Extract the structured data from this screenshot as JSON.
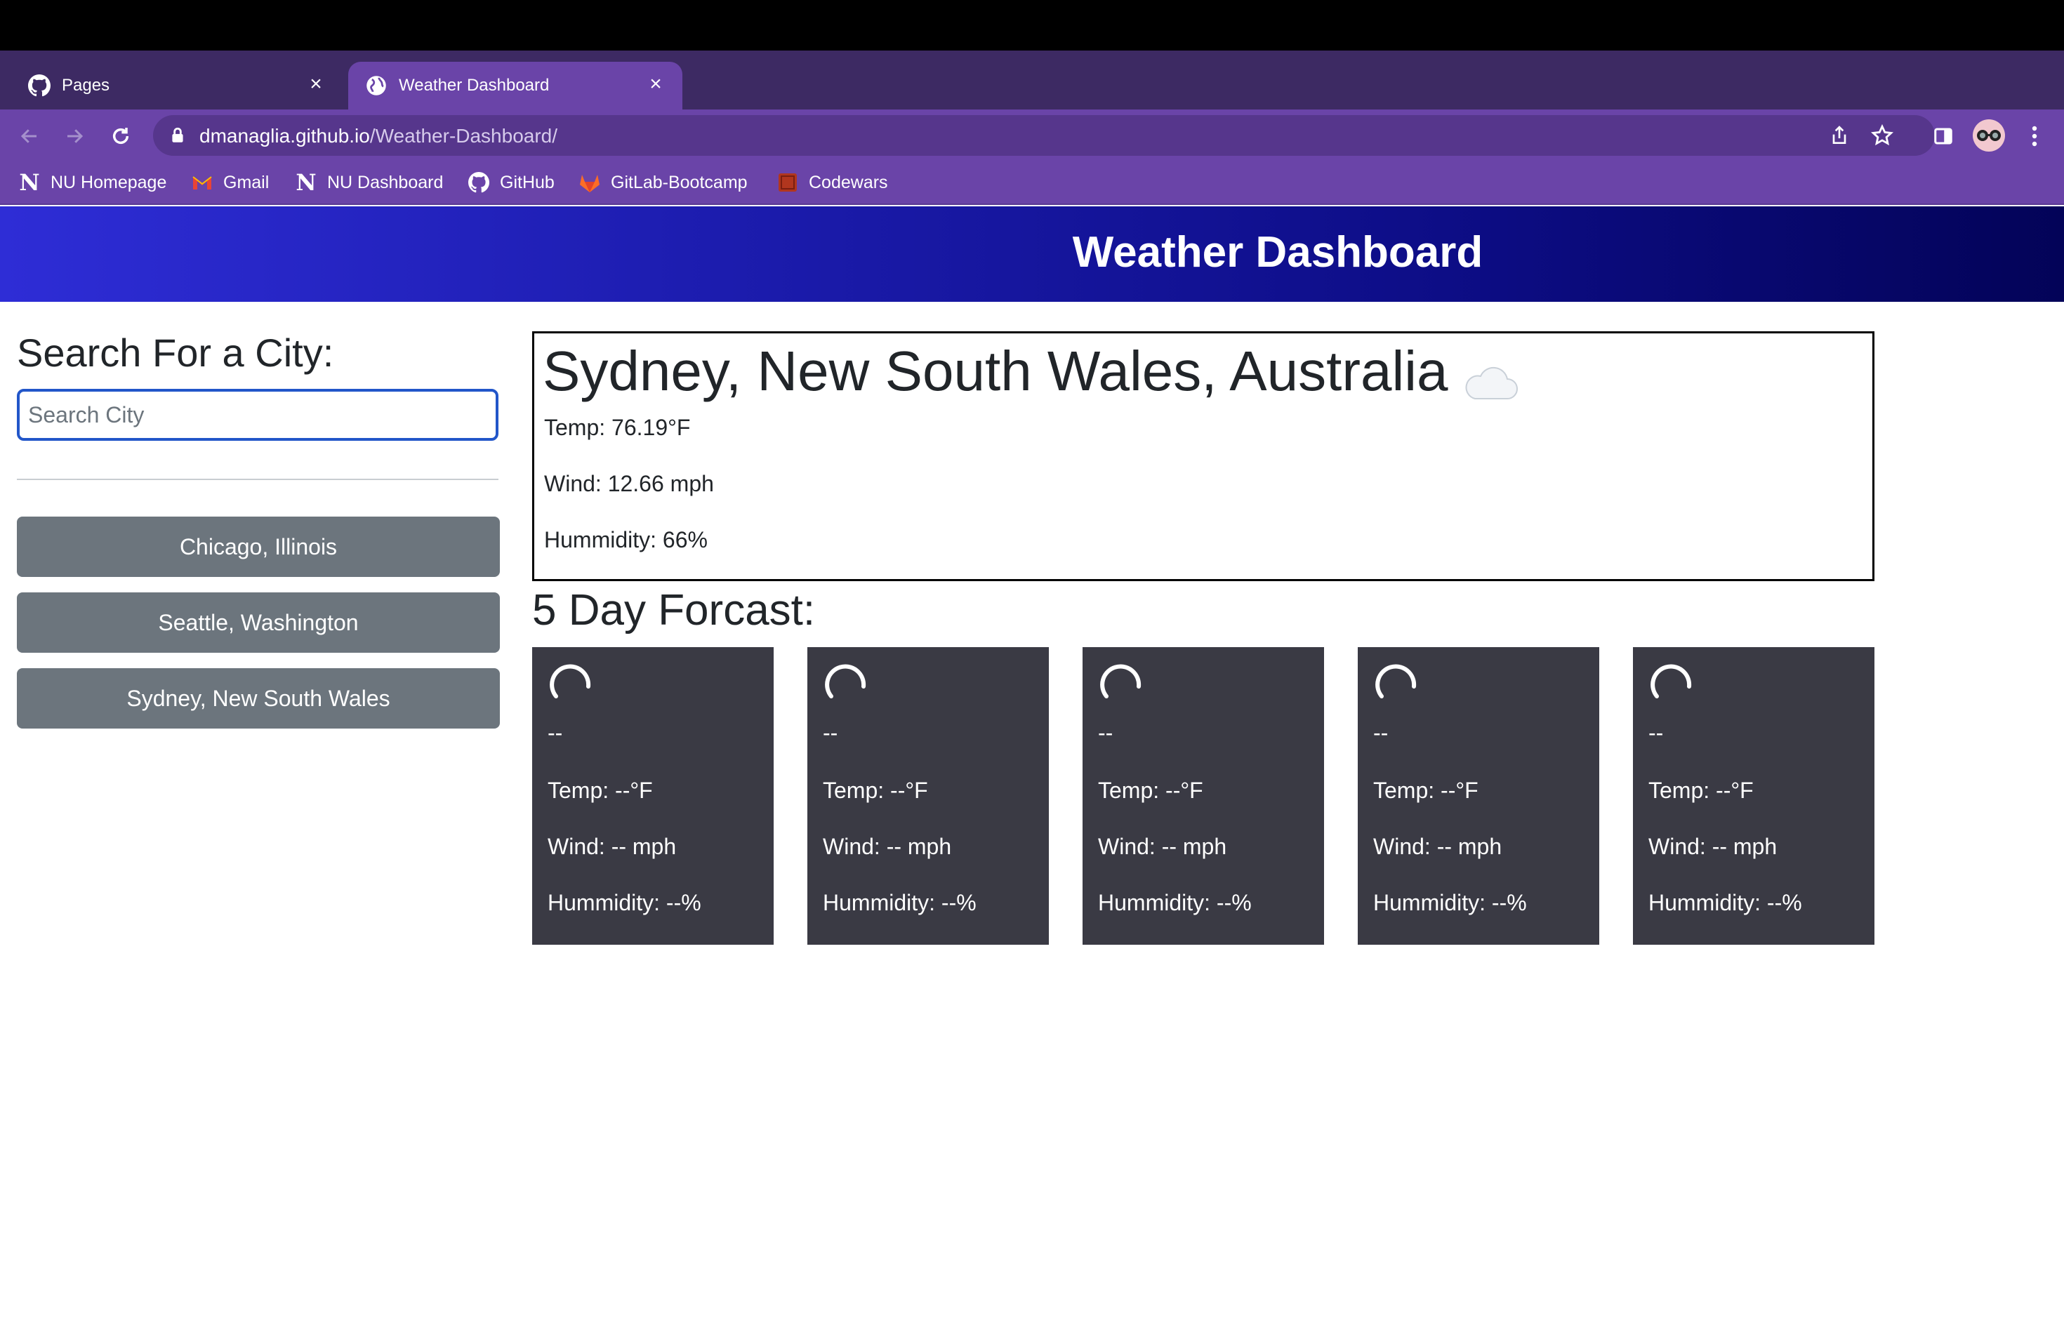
{
  "browser": {
    "tabs": [
      {
        "title": "Pages",
        "icon": "github-icon",
        "active": false
      },
      {
        "title": "Weather Dashboard",
        "icon": "globe-icon",
        "active": true
      }
    ],
    "url_host": "dmanaglia.github.io",
    "url_path": "/Weather-Dashboard/",
    "bookmarks": [
      {
        "label": "NU Homepage",
        "icon": "northwestern-n-icon"
      },
      {
        "label": "Gmail",
        "icon": "gmail-icon"
      },
      {
        "label": "NU Dashboard",
        "icon": "northwestern-n-icon"
      },
      {
        "label": "GitHub",
        "icon": "github-icon"
      },
      {
        "label": "GitLab-Bootcamp",
        "icon": "gitlab-icon"
      },
      {
        "label": "Codewars",
        "icon": "codewars-icon"
      }
    ],
    "theme_color": "#6a44a8"
  },
  "app": {
    "title": "Weather Dashboard",
    "header_gradient": [
      "#2e2dd6",
      "#030358"
    ]
  },
  "search": {
    "heading": "Search For a City:",
    "placeholder": "Search City",
    "value": "",
    "history": [
      "Chicago, Illinois",
      "Seattle, Washington",
      "Sydney, New South Wales"
    ]
  },
  "current": {
    "city": "Sydney, New South Wales, Australia",
    "icon": "cloud-icon",
    "temp": "Temp: 76.19°F",
    "wind": "Wind: 12.66 mph",
    "humidity": "Hummidity: 66%"
  },
  "forecast": {
    "heading": "5 Day Forcast:",
    "days": [
      {
        "date": "--",
        "temp": "Temp: --°F",
        "wind": "Wind: -- mph",
        "humidity": "Hummidity: --%"
      },
      {
        "date": "--",
        "temp": "Temp: --°F",
        "wind": "Wind: -- mph",
        "humidity": "Hummidity: --%"
      },
      {
        "date": "--",
        "temp": "Temp: --°F",
        "wind": "Wind: -- mph",
        "humidity": "Hummidity: --%"
      },
      {
        "date": "--",
        "temp": "Temp: --°F",
        "wind": "Wind: -- mph",
        "humidity": "Hummidity: --%"
      },
      {
        "date": "--",
        "temp": "Temp: --°F",
        "wind": "Wind: -- mph",
        "humidity": "Hummidity: --%"
      }
    ],
    "card_color": "#3a3a44"
  }
}
